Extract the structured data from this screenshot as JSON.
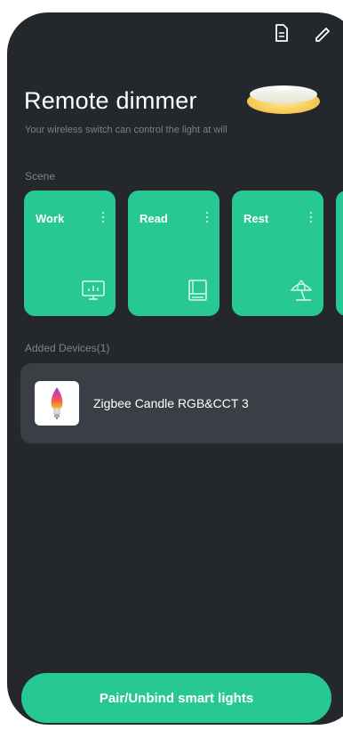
{
  "header": {
    "title": "Remote dimmer",
    "subtitle": "Your wireless switch can control the light at will",
    "icons": [
      "document-icon",
      "edit-icon"
    ]
  },
  "scene_section": {
    "label": "Scene",
    "items": [
      {
        "name": "Work",
        "icon": "monitor-icon"
      },
      {
        "name": "Read",
        "icon": "book-icon"
      },
      {
        "name": "Rest",
        "icon": "beach-umbrella-icon"
      },
      {
        "name": "",
        "icon": ""
      }
    ]
  },
  "devices_section": {
    "label": "Added Devices(1)",
    "items": [
      {
        "name": "Zigbee Candle RGB&CCT 3",
        "icon": "candle-bulb-icon"
      }
    ]
  },
  "pair_button": {
    "label": "Pair/Unbind smart lights"
  },
  "colors": {
    "background": "#24272c",
    "accent": "#27c892",
    "card": "#3a3e45",
    "text_primary": "#ffffff",
    "text_secondary": "#7c8088"
  }
}
